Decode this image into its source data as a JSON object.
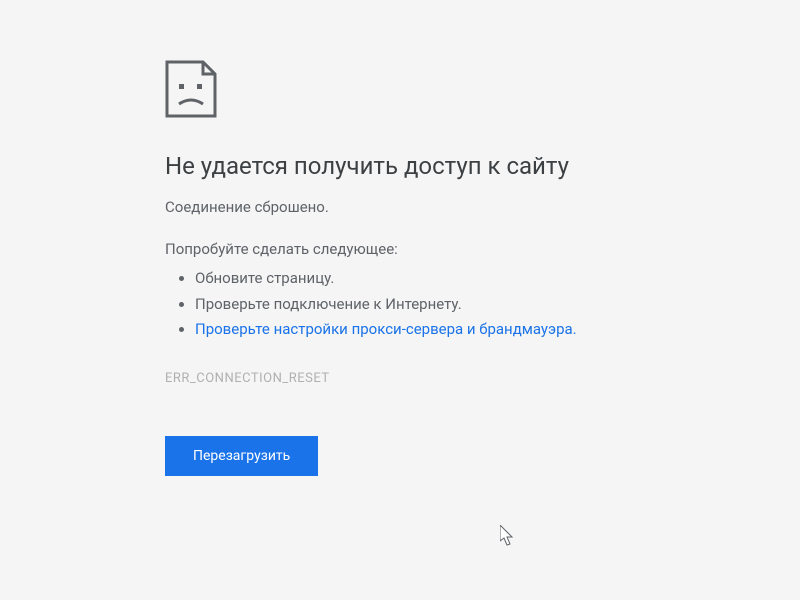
{
  "error": {
    "title": "Не удается получить доступ к сайту",
    "subtitle": "Соединение сброшено.",
    "suggestions_label": "Попробуйте сделать следующее:",
    "suggestions": {
      "item1": "Обновите страницу.",
      "item2": "Проверьте подключение к Интернету.",
      "item3_link": "Проверьте настройки прокси-сервера и брандмауэра."
    },
    "code": "ERR_CONNECTION_RESET",
    "reload_button": "Перезагрузить"
  }
}
